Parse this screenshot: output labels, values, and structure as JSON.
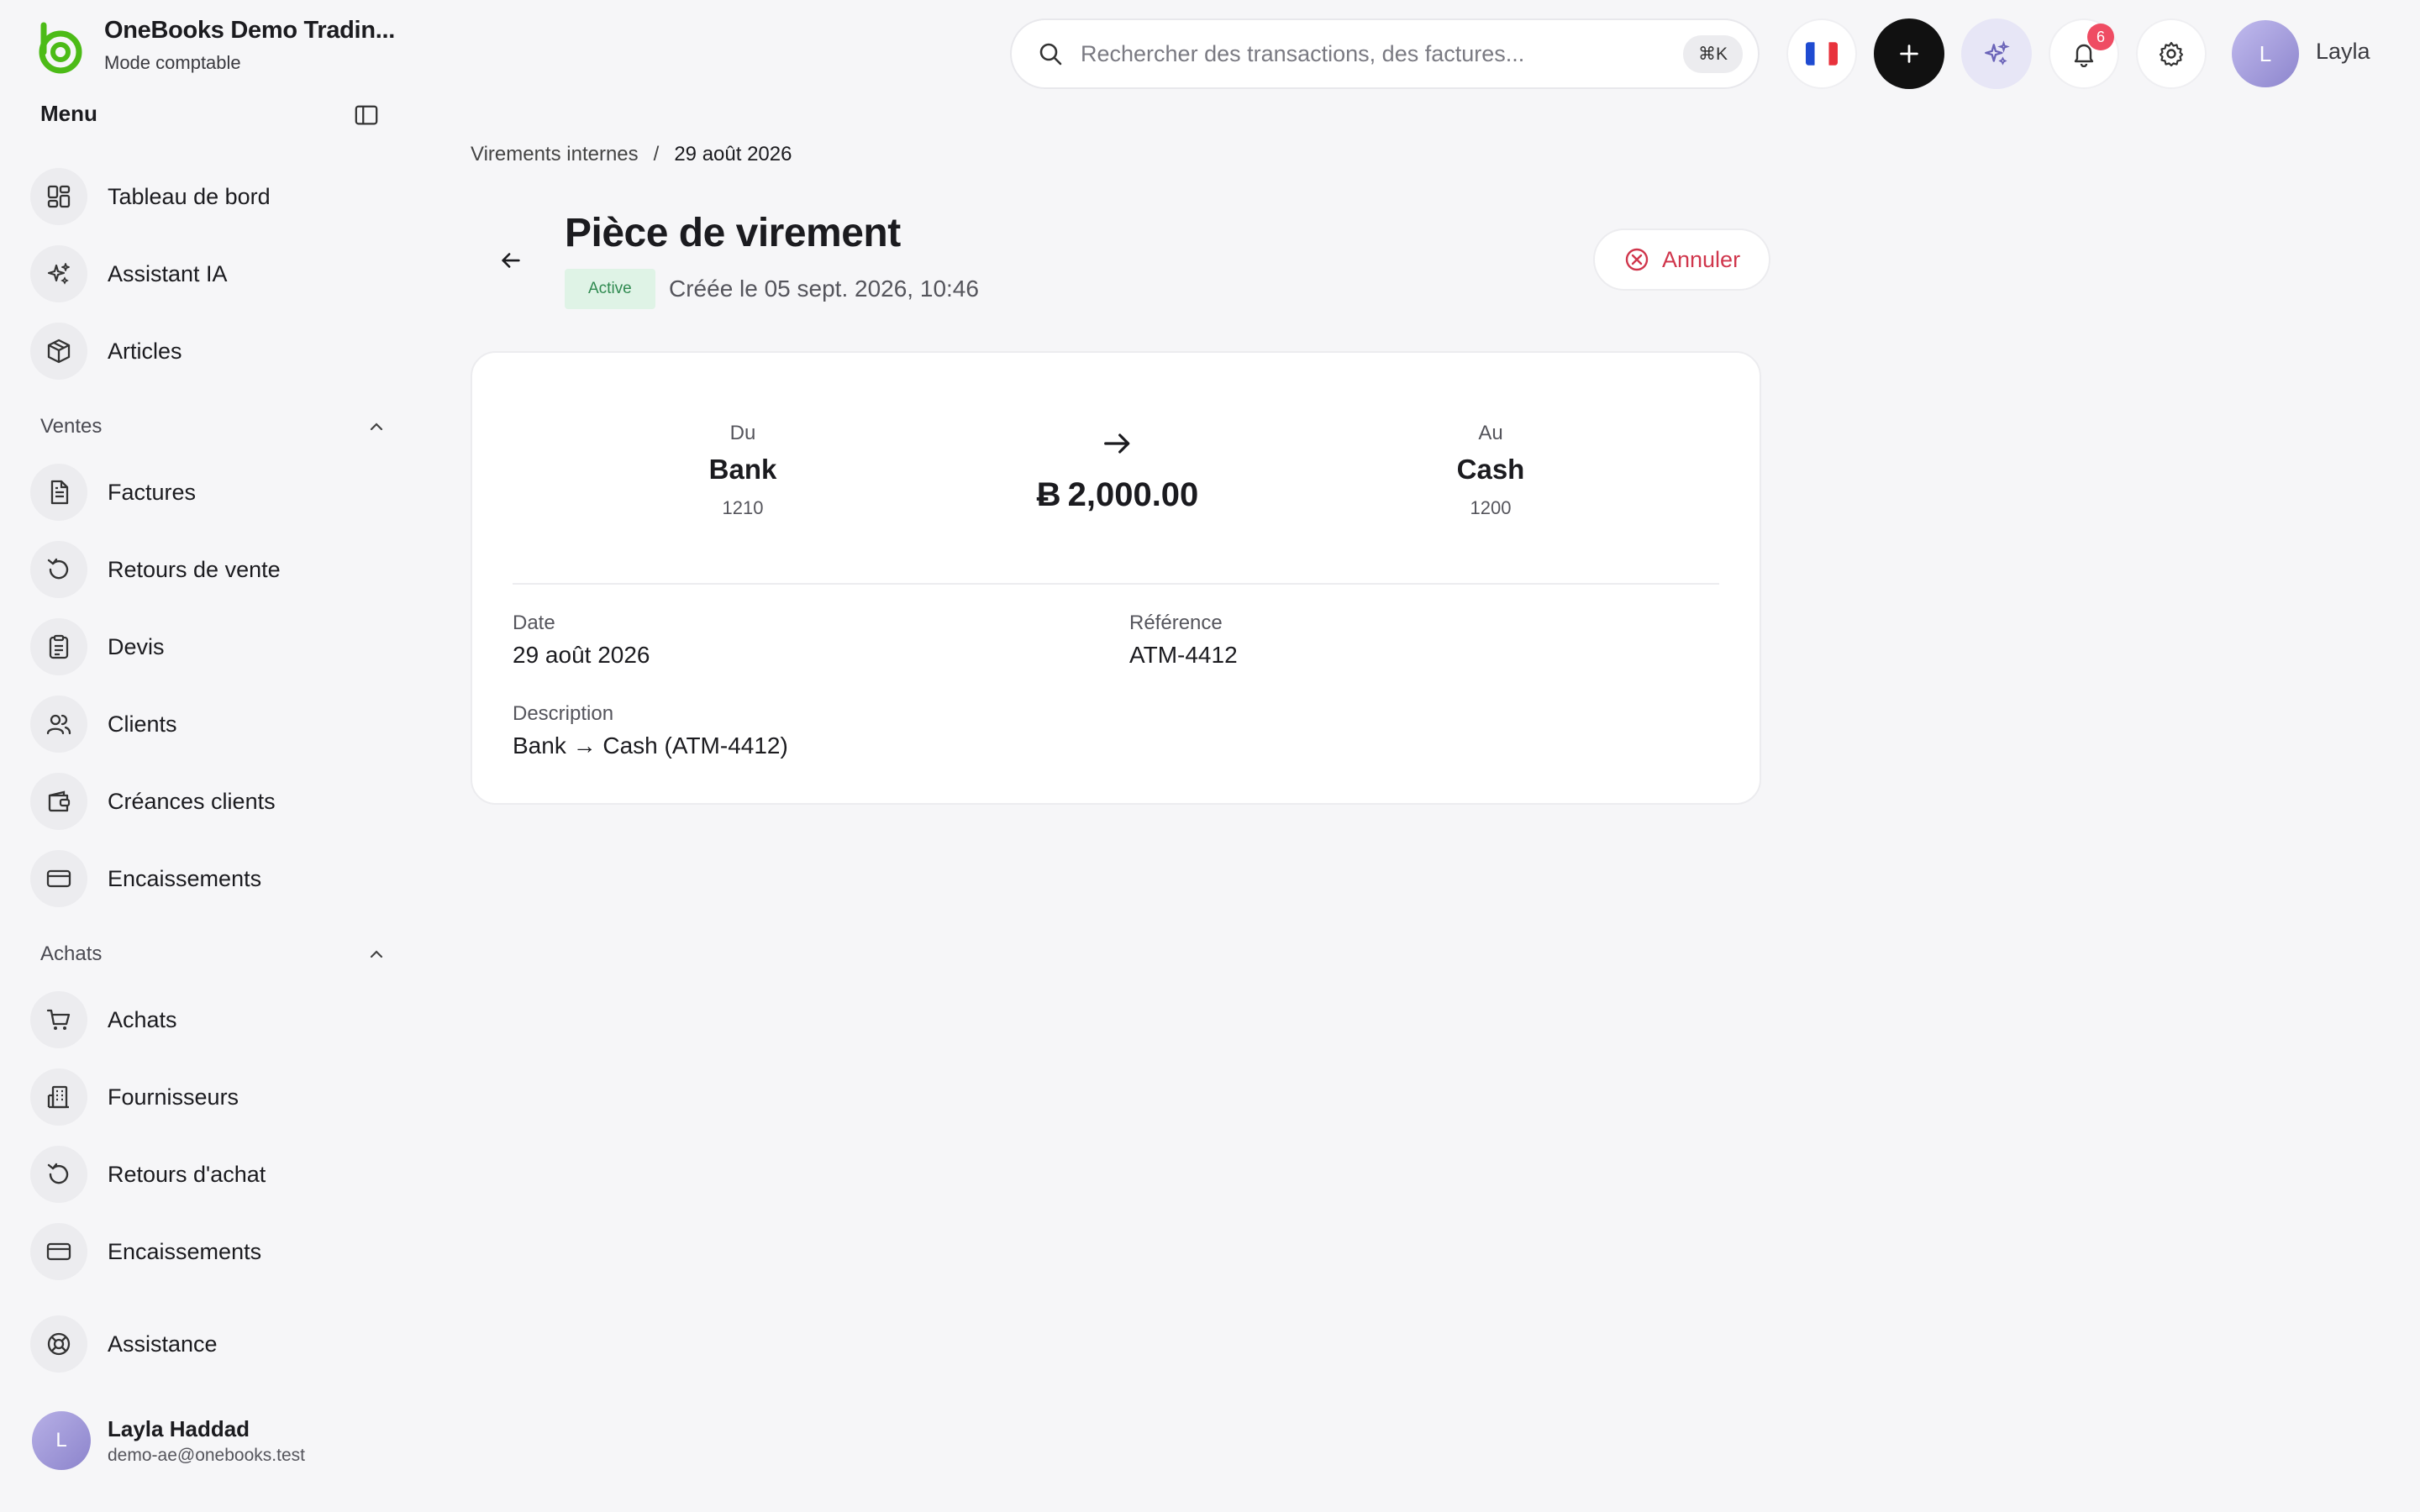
{
  "brand": {
    "name": "OneBooks Demo Tradin...",
    "mode": "Mode comptable",
    "accent": "#4cbb17"
  },
  "sidebar": {
    "menu_title": "Menu",
    "top_items": [
      {
        "label": "Tableau de bord",
        "icon": "dashboard-icon"
      },
      {
        "label": "Assistant IA",
        "icon": "sparkles-icon"
      },
      {
        "label": "Articles",
        "icon": "box-icon"
      }
    ],
    "sections": [
      {
        "title": "Ventes",
        "items": [
          {
            "label": "Factures",
            "icon": "document-icon"
          },
          {
            "label": "Retours de vente",
            "icon": "return-icon"
          },
          {
            "label": "Devis",
            "icon": "clipboard-icon"
          },
          {
            "label": "Clients",
            "icon": "users-icon"
          },
          {
            "label": "Créances clients",
            "icon": "wallet-icon"
          },
          {
            "label": "Encaissements",
            "icon": "card-icon"
          }
        ]
      },
      {
        "title": "Achats",
        "items": [
          {
            "label": "Achats",
            "icon": "cart-icon"
          },
          {
            "label": "Fournisseurs",
            "icon": "building-icon"
          },
          {
            "label": "Retours d'achat",
            "icon": "return-icon"
          },
          {
            "label": "Encaissements",
            "icon": "card-icon"
          }
        ]
      }
    ],
    "support": {
      "label": "Assistance",
      "icon": "lifebuoy-icon"
    },
    "user": {
      "initial": "L",
      "name": "Layla Haddad",
      "email": "demo-ae@onebooks.test"
    }
  },
  "topbar": {
    "search_placeholder": "Rechercher des transactions, des factures...",
    "shortcut": "⌘K",
    "notifications_count": "6",
    "user_initial": "L",
    "user_name": "Layla"
  },
  "breadcrumb": {
    "parent": "Virements internes",
    "separator": "/",
    "current": "29 août 2026"
  },
  "page": {
    "title": "Pièce de virement",
    "status": "Active",
    "created": "Créée le 05 sept. 2026, 10:46",
    "cancel_label": "Annuler"
  },
  "transfer": {
    "from_label": "Du",
    "from_account": "Bank",
    "from_code": "1210",
    "to_label": "Au",
    "to_account": "Cash",
    "to_code": "1200",
    "currency_symbol": "Ƀ",
    "amount": "2,000.00",
    "date_label": "Date",
    "date_value": "29 août 2026",
    "reference_label": "Référence",
    "reference_value": "ATM-4412",
    "description_label": "Description",
    "description_value": "Bank → Cash (ATM-4412)"
  }
}
